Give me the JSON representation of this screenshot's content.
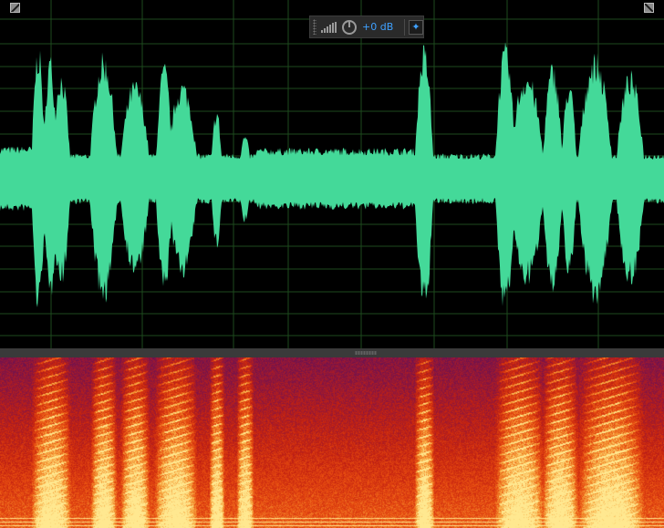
{
  "waveform": {
    "color": "#44d999",
    "background": "#000000",
    "grid_color": "#1e4a1e",
    "vertical_gridlines": 7,
    "horizontal_gridlines": 12
  },
  "hud": {
    "gain_label": "+0 dB",
    "level_meter_icon": "signal-bars-icon",
    "knob_icon": "volume-knob-icon",
    "pin_icon": "pin-icon",
    "accent_color": "#3fa1ff"
  },
  "spectral": {
    "palette": [
      "#2a0a3a",
      "#55115a",
      "#8a1540",
      "#c42210",
      "#e84d10",
      "#f6a23a",
      "#ffe890"
    ]
  }
}
